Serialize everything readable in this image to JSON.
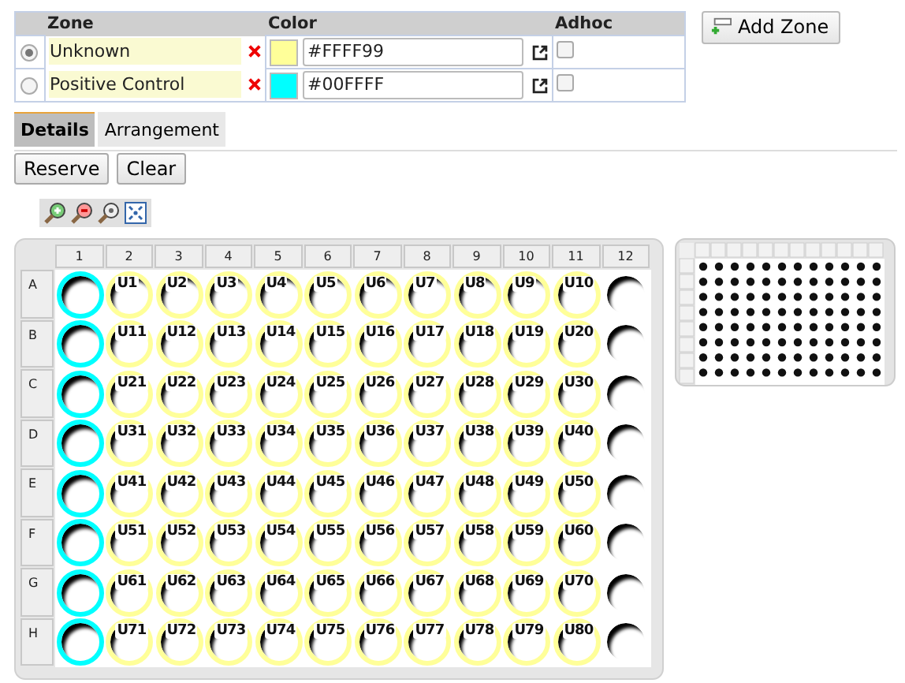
{
  "zone_table": {
    "columns": [
      "Zone",
      "Color",
      "Adhoc"
    ],
    "rows": [
      {
        "selected": true,
        "name": "Unknown",
        "color": "#ffff99",
        "color_value": "#FFFF99",
        "adhoc": false
      },
      {
        "selected": false,
        "name": "Positive Control",
        "color": "#00ffff",
        "color_value": "#00FFFF",
        "adhoc": false
      }
    ]
  },
  "add_zone_button": "Add Zone",
  "tabs": [
    {
      "label": "Details",
      "selected": true
    },
    {
      "label": "Arrangement",
      "selected": false
    }
  ],
  "buttons": [
    "Reserve",
    "Clear"
  ],
  "plate": {
    "columns": [
      "1",
      "2",
      "3",
      "4",
      "5",
      "6",
      "7",
      "8",
      "9",
      "10",
      "11",
      "12"
    ],
    "rows": [
      {
        "label": "A",
        "wells": [
          {
            "color": "#00ffff"
          },
          {
            "label": "U1",
            "color": "#ffff99"
          },
          {
            "label": "U2",
            "color": "#ffff99"
          },
          {
            "label": "U3",
            "color": "#ffff99"
          },
          {
            "label": "U4",
            "color": "#ffff99"
          },
          {
            "label": "U5",
            "color": "#ffff99"
          },
          {
            "label": "U6",
            "color": "#ffff99"
          },
          {
            "label": "U7",
            "color": "#ffff99"
          },
          {
            "label": "U8",
            "color": "#ffff99"
          },
          {
            "label": "U9",
            "color": "#ffff99"
          },
          {
            "label": "U10",
            "color": "#ffff99"
          },
          {
            "color": "#ffffff"
          }
        ]
      },
      {
        "label": "B",
        "wells": [
          {
            "color": "#00ffff"
          },
          {
            "label": "U11",
            "color": "#ffff99"
          },
          {
            "label": "U12",
            "color": "#ffff99"
          },
          {
            "label": "U13",
            "color": "#ffff99"
          },
          {
            "label": "U14",
            "color": "#ffff99"
          },
          {
            "label": "U15",
            "color": "#ffff99"
          },
          {
            "label": "U16",
            "color": "#ffff99"
          },
          {
            "label": "U17",
            "color": "#ffff99"
          },
          {
            "label": "U18",
            "color": "#ffff99"
          },
          {
            "label": "U19",
            "color": "#ffff99"
          },
          {
            "label": "U20",
            "color": "#ffff99"
          },
          {
            "color": "#ffffff"
          }
        ]
      },
      {
        "label": "C",
        "wells": [
          {
            "color": "#00ffff"
          },
          {
            "label": "U21",
            "color": "#ffff99"
          },
          {
            "label": "U22",
            "color": "#ffff99"
          },
          {
            "label": "U23",
            "color": "#ffff99"
          },
          {
            "label": "U24",
            "color": "#ffff99"
          },
          {
            "label": "U25",
            "color": "#ffff99"
          },
          {
            "label": "U26",
            "color": "#ffff99"
          },
          {
            "label": "U27",
            "color": "#ffff99"
          },
          {
            "label": "U28",
            "color": "#ffff99"
          },
          {
            "label": "U29",
            "color": "#ffff99"
          },
          {
            "label": "U30",
            "color": "#ffff99"
          },
          {
            "color": "#ffffff"
          }
        ]
      },
      {
        "label": "D",
        "wells": [
          {
            "color": "#00ffff"
          },
          {
            "label": "U31",
            "color": "#ffff99"
          },
          {
            "label": "U32",
            "color": "#ffff99"
          },
          {
            "label": "U33",
            "color": "#ffff99"
          },
          {
            "label": "U34",
            "color": "#ffff99"
          },
          {
            "label": "U35",
            "color": "#ffff99"
          },
          {
            "label": "U36",
            "color": "#ffff99"
          },
          {
            "label": "U37",
            "color": "#ffff99"
          },
          {
            "label": "U38",
            "color": "#ffff99"
          },
          {
            "label": "U39",
            "color": "#ffff99"
          },
          {
            "label": "U40",
            "color": "#ffff99"
          },
          {
            "color": "#ffffff"
          }
        ]
      },
      {
        "label": "E",
        "wells": [
          {
            "color": "#00ffff"
          },
          {
            "label": "U41",
            "color": "#ffff99"
          },
          {
            "label": "U42",
            "color": "#ffff99"
          },
          {
            "label": "U43",
            "color": "#ffff99"
          },
          {
            "label": "U44",
            "color": "#ffff99"
          },
          {
            "label": "U45",
            "color": "#ffff99"
          },
          {
            "label": "U46",
            "color": "#ffff99"
          },
          {
            "label": "U47",
            "color": "#ffff99"
          },
          {
            "label": "U48",
            "color": "#ffff99"
          },
          {
            "label": "U49",
            "color": "#ffff99"
          },
          {
            "label": "U50",
            "color": "#ffff99"
          },
          {
            "color": "#ffffff"
          }
        ]
      },
      {
        "label": "F",
        "wells": [
          {
            "color": "#00ffff"
          },
          {
            "label": "U51",
            "color": "#ffff99"
          },
          {
            "label": "U52",
            "color": "#ffff99"
          },
          {
            "label": "U53",
            "color": "#ffff99"
          },
          {
            "label": "U54",
            "color": "#ffff99"
          },
          {
            "label": "U55",
            "color": "#ffff99"
          },
          {
            "label": "U56",
            "color": "#ffff99"
          },
          {
            "label": "U57",
            "color": "#ffff99"
          },
          {
            "label": "U58",
            "color": "#ffff99"
          },
          {
            "label": "U59",
            "color": "#ffff99"
          },
          {
            "label": "U60",
            "color": "#ffff99"
          },
          {
            "color": "#ffffff"
          }
        ]
      },
      {
        "label": "G",
        "wells": [
          {
            "color": "#00ffff"
          },
          {
            "label": "U61",
            "color": "#ffff99"
          },
          {
            "label": "U62",
            "color": "#ffff99"
          },
          {
            "label": "U63",
            "color": "#ffff99"
          },
          {
            "label": "U64",
            "color": "#ffff99"
          },
          {
            "label": "U65",
            "color": "#ffff99"
          },
          {
            "label": "U66",
            "color": "#ffff99"
          },
          {
            "label": "U67",
            "color": "#ffff99"
          },
          {
            "label": "U68",
            "color": "#ffff99"
          },
          {
            "label": "U69",
            "color": "#ffff99"
          },
          {
            "label": "U70",
            "color": "#ffff99"
          },
          {
            "color": "#ffffff"
          }
        ]
      },
      {
        "label": "H",
        "wells": [
          {
            "color": "#00ffff"
          },
          {
            "label": "U71",
            "color": "#ffff99"
          },
          {
            "label": "U72",
            "color": "#ffff99"
          },
          {
            "label": "U73",
            "color": "#ffff99"
          },
          {
            "label": "U74",
            "color": "#ffff99"
          },
          {
            "label": "U75",
            "color": "#ffff99"
          },
          {
            "label": "U76",
            "color": "#ffff99"
          },
          {
            "label": "U77",
            "color": "#ffff99"
          },
          {
            "label": "U78",
            "color": "#ffff99"
          },
          {
            "label": "U79",
            "color": "#ffff99"
          },
          {
            "label": "U80",
            "color": "#ffff99"
          },
          {
            "color": "#ffffff"
          }
        ]
      }
    ]
  }
}
